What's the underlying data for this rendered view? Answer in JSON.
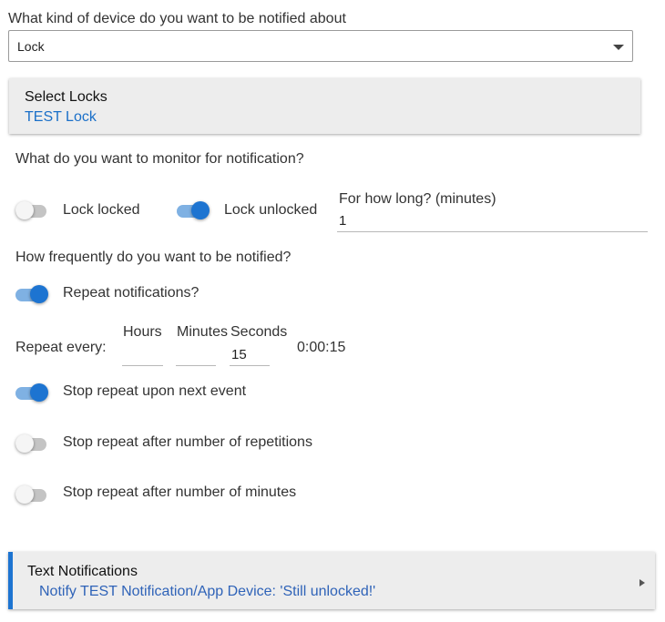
{
  "device_type": {
    "question": "What kind of device do you want to be notified about",
    "selected": "Lock"
  },
  "select_locks": {
    "title": "Select Locks",
    "value": "TEST Lock"
  },
  "monitor": {
    "question": "What do you want to monitor for notification?",
    "lock_locked": {
      "label": "Lock locked",
      "on": false
    },
    "lock_unlocked": {
      "label": "Lock unlocked",
      "on": true
    },
    "duration_label": "For how long? (minutes)",
    "duration_value": "1"
  },
  "frequency": {
    "question": "How frequently do you want to be notified?",
    "repeat_notifications": {
      "label": "Repeat notifications?",
      "on": true
    },
    "repeat_every_label": "Repeat every:",
    "hours_label": "Hours",
    "minutes_label": "Minutes",
    "seconds_label": "Seconds",
    "hours_value": "",
    "minutes_value": "",
    "seconds_value": "15",
    "computed_interval": "0:00:15",
    "stop_next_event": {
      "label": "Stop repeat upon next event",
      "on": true
    },
    "stop_after_repetitions": {
      "label": "Stop repeat after number of repetitions",
      "on": false
    },
    "stop_after_minutes": {
      "label": "Stop repeat after number of minutes",
      "on": false
    }
  },
  "text_notifications": {
    "title": "Text Notifications",
    "summary": "Notify TEST Notification/App Device: 'Still unlocked!'"
  },
  "colors": {
    "accent": "#1d74d1",
    "link_blue": "#1a6fc8",
    "card_bg": "#ededed",
    "left_border": "#1d74d1"
  }
}
